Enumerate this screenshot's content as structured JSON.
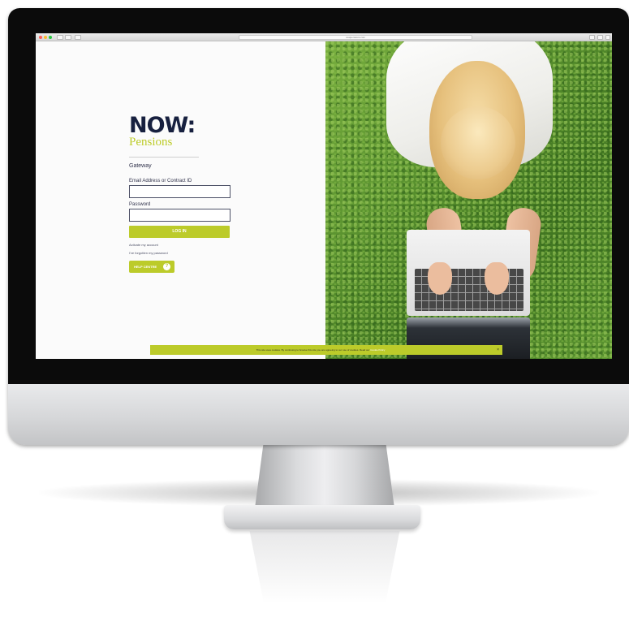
{
  "browser": {
    "url": "nowpensions.com"
  },
  "brand": {
    "logo_word": "NOW:",
    "logo_subword": "Pensions",
    "accent_color": "#bccb2a",
    "navy_color": "#17203f"
  },
  "login": {
    "section_title": "Gateway",
    "email_label": "Email Address or Contract ID",
    "email_value": "",
    "password_label": "Password",
    "password_value": "",
    "login_button": "LOG IN",
    "activate_link": "Activate my account",
    "forgot_link": "I've forgotten my password",
    "help_button": "HELP CENTRE",
    "help_icon_glyph": "?"
  },
  "cookie_banner": {
    "text": "This site uses cookies. By continuing to browse this site you are agreeing to our use of cookies. Read our",
    "link_text": "Cookie Policy",
    "close_glyph": "×"
  },
  "hero": {
    "image_icon": "person-with-laptop-on-grass-photo"
  }
}
